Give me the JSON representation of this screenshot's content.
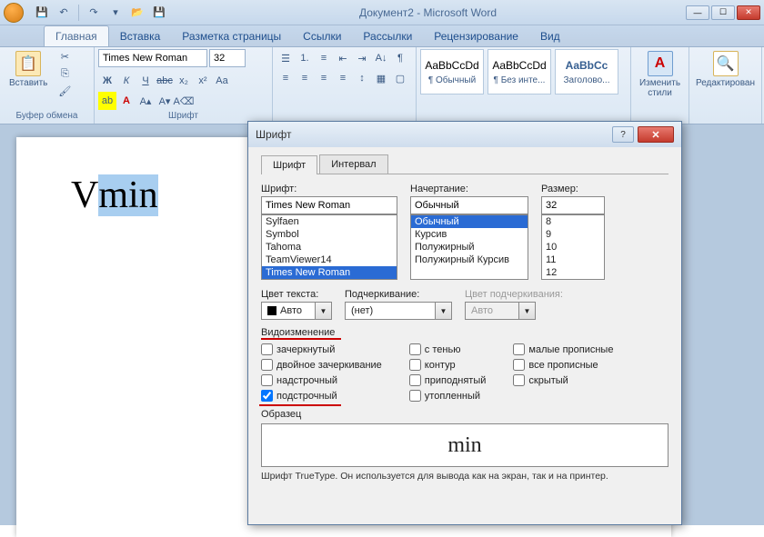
{
  "title": "Документ2 - Microsoft Word",
  "qat": {
    "save": "💾",
    "undo": "↶",
    "redo": "↷",
    "print": "🖶",
    "open": "📂"
  },
  "tabs": [
    "Главная",
    "Вставка",
    "Разметка страницы",
    "Ссылки",
    "Рассылки",
    "Рецензирование",
    "Вид"
  ],
  "ribbon": {
    "clipboard": {
      "paste": "Вставить",
      "label": "Буфер обмена"
    },
    "font": {
      "name": "Times New Roman",
      "size": "32",
      "label": "Шрифт"
    },
    "styles": [
      {
        "preview": "AaBbCcDd",
        "name": "¶ Обычный"
      },
      {
        "preview": "AaBbCcDd",
        "name": "¶ Без инте..."
      },
      {
        "preview": "AaBbCc",
        "name": "Заголово..."
      }
    ],
    "change_styles": "Изменить стили",
    "editing": "Редактирован"
  },
  "doc": {
    "v": "V",
    "min": "min"
  },
  "dialog": {
    "title": "Шрифт",
    "tabs": [
      "Шрифт",
      "Интервал"
    ],
    "font_label": "Шрифт:",
    "font_value": "Times New Roman",
    "font_list": [
      "Sylfaen",
      "Symbol",
      "Tahoma",
      "TeamViewer14",
      "Times New Roman"
    ],
    "style_label": "Начертание:",
    "style_value": "Обычный",
    "style_list": [
      "Обычный",
      "Курсив",
      "Полужирный",
      "Полужирный Курсив"
    ],
    "size_label": "Размер:",
    "size_value": "32",
    "size_list": [
      "8",
      "9",
      "10",
      "11",
      "12"
    ],
    "color_label": "Цвет текста:",
    "color_value": "Авто",
    "underline_label": "Подчеркивание:",
    "underline_value": "(нет)",
    "ucolor_label": "Цвет подчеркивания:",
    "ucolor_value": "Авто",
    "effects_label": "Видоизменение",
    "effects": {
      "strike": "зачеркнутый",
      "dstrike": "двойное зачеркивание",
      "super": "надстрочный",
      "sub": "подстрочный",
      "shadow": "с тенью",
      "outline": "контур",
      "emboss": "приподнятый",
      "engrave": "утопленный",
      "smallcaps": "малые прописные",
      "allcaps": "все прописные",
      "hidden": "скрытый"
    },
    "sample_label": "Образец",
    "sample_text": "min",
    "footnote": "Шрифт TrueType. Он используется для вывода как на экран, так и на принтер."
  }
}
